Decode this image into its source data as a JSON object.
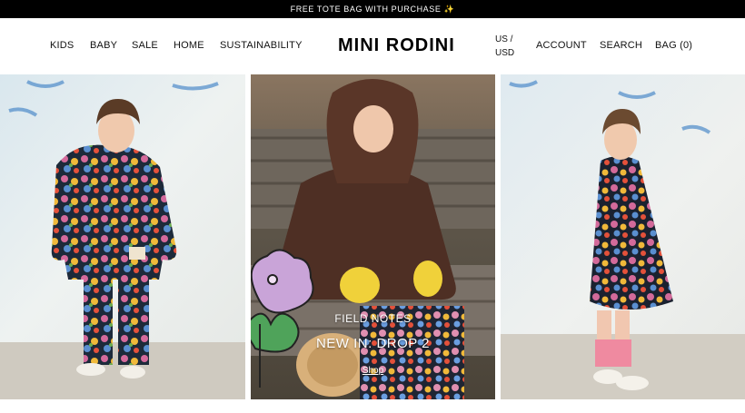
{
  "announcement": "FREE TOTE BAG WITH PURCHASE ✨",
  "nav": {
    "left": [
      "KIDS",
      "BABY",
      "SALE",
      "HOME",
      "SUSTAINABILITY"
    ],
    "logo": "MINI RODINI",
    "locale_line1": "US /",
    "locale_line2": "USD",
    "account": "ACCOUNT",
    "search": "SEARCH",
    "bag": "BAG (0)"
  },
  "hero": {
    "kicker": "FIELD NOTES",
    "title": "NEW IN: DROP 2",
    "cta": "Shop"
  },
  "colors": {
    "announce_bg": "#000000",
    "nav_bg": "#ffffff",
    "text": "#111111",
    "overlay_text": "#ffffff"
  },
  "images": {
    "left": "child in floral puffer jacket and trousers",
    "center": "child in brown faux-fur bunny-ear coat",
    "right": "child in black floral dress"
  }
}
